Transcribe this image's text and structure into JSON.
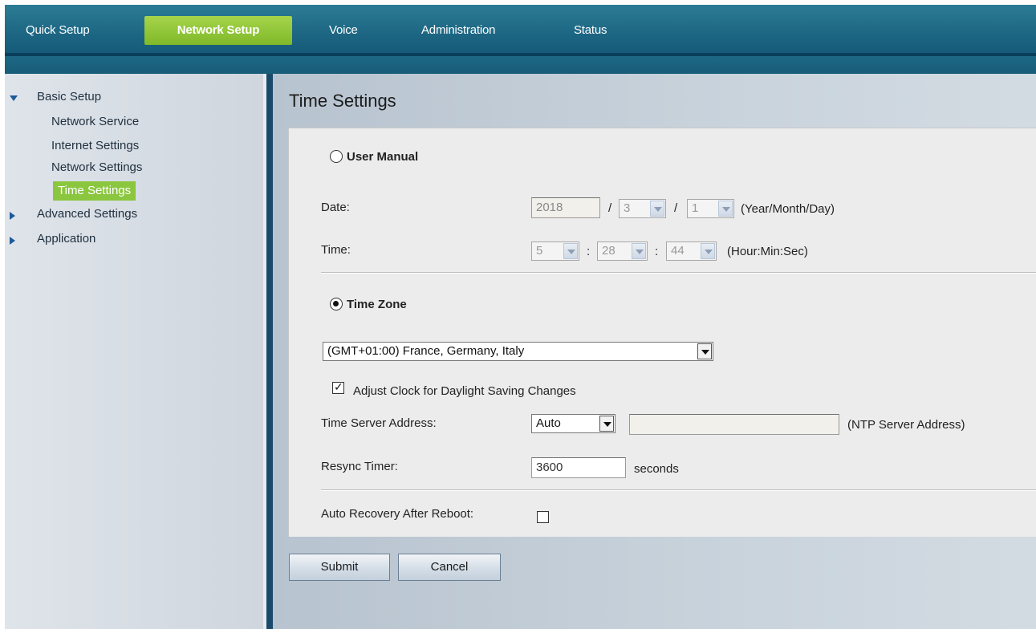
{
  "top_nav": {
    "tabs": [
      {
        "label": "Quick Setup",
        "active": false
      },
      {
        "label": "Network Setup",
        "active": true
      },
      {
        "label": "Voice",
        "active": false
      },
      {
        "label": "Administration",
        "active": false
      },
      {
        "label": "Status",
        "active": false
      }
    ],
    "accent_color": "#8bc63f"
  },
  "sidebar": {
    "groups": [
      {
        "label": "Basic Setup",
        "expanded": true,
        "items": [
          {
            "label": "Network Service",
            "active": false
          },
          {
            "label": "Internet Settings",
            "active": false
          },
          {
            "label": "Network Settings",
            "active": false
          },
          {
            "label": "Time Settings",
            "active": true
          }
        ]
      },
      {
        "label": "Advanced Settings",
        "expanded": false
      },
      {
        "label": "Application",
        "expanded": false
      }
    ]
  },
  "page": {
    "title": "Time Settings",
    "user_manual": {
      "label": "User Manual",
      "selected": false,
      "date_label": "Date:",
      "year": "2018",
      "sep1": "/",
      "month": "3",
      "sep2": "/",
      "day": "1",
      "date_hint": "(Year/Month/Day)",
      "time_label": "Time:",
      "hour": "5",
      "tsep1": ":",
      "minute": "28",
      "tsep2": ":",
      "second": "44",
      "time_hint": "(Hour:Min:Sec)"
    },
    "time_zone": {
      "label": "Time Zone",
      "selected": true,
      "zone_value": "(GMT+01:00) France, Germany, Italy",
      "dst_label": "Adjust Clock for Daylight Saving Changes",
      "dst_checked": true,
      "server_label": "Time Server Address:",
      "server_mode": "Auto",
      "server_address": "",
      "server_hint": "(NTP Server Address)",
      "resync_label": "Resync Timer:",
      "resync_value": "3600",
      "resync_unit": "seconds"
    },
    "auto_recovery": {
      "label": "Auto Recovery After Reboot:",
      "checked": false
    },
    "buttons": {
      "submit": "Submit",
      "cancel": "Cancel"
    }
  }
}
